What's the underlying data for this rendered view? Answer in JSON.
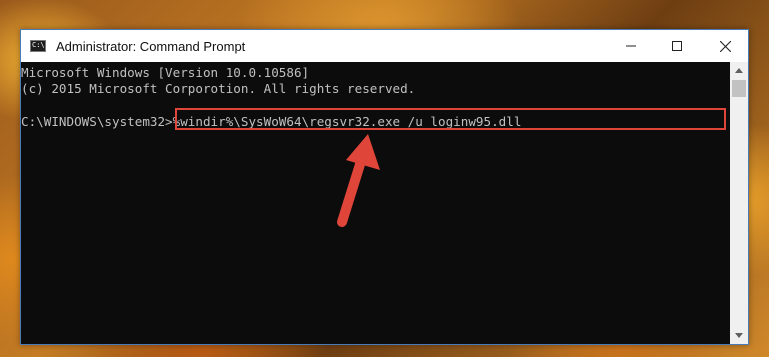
{
  "window": {
    "title": "Administrator: Command Prompt",
    "icon_text": "C:\\",
    "controls": {
      "minimize": "minimize-icon",
      "maximize": "maximize-icon",
      "close": "close-icon"
    }
  },
  "console": {
    "lines": [
      "Microsoft Windows [Version 10.0.10586]",
      "(c) 2015 Microsoft Corporotion. All rights reserved.",
      "C:\\WINDOWS\\system32>%windir%\\SysWoW64\\regsvr32.exe /u loginw95.dll"
    ]
  },
  "annotation": {
    "highlight_color": "#e0453a",
    "arrow_color": "#e0453a"
  },
  "scrollbar": {
    "up_icon": "scroll-up-icon",
    "down_icon": "scroll-down-icon"
  }
}
